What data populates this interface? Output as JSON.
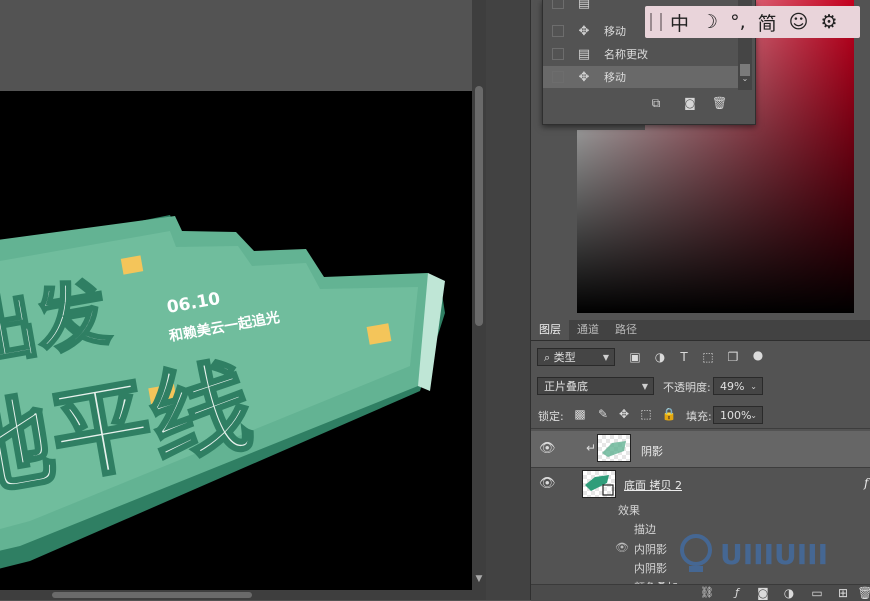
{
  "history": {
    "items": [
      {
        "label": "移动",
        "icon": "move-icon"
      },
      {
        "label": "名称更改",
        "icon": "document-icon"
      },
      {
        "label": "移动",
        "icon": "move-icon",
        "selected": true
      }
    ],
    "footer_icons": [
      "new-snapshot-icon",
      "camera-icon",
      "trash-icon"
    ]
  },
  "ime_bar": {
    "items": [
      "中",
      "☽",
      "°,",
      "简",
      "☺",
      "⚙"
    ]
  },
  "artwork": {
    "date": "06.10",
    "tagline": "和赖美云一起追光",
    "big_text_line1": "出发",
    "big_text_line2": "地平线",
    "colors": {
      "face": "#e6f1ec",
      "mint": "#63b393",
      "deep": "#2f7f63",
      "gold": "#f4c55a"
    }
  },
  "layers_panel": {
    "tabs": [
      "图层",
      "通道",
      "路径"
    ],
    "active_tab": "图层",
    "filter_kind": "类型",
    "blend_mode": "正片叠底",
    "opacity_label": "不透明度:",
    "opacity_value": "49%",
    "lock_label": "锁定:",
    "fill_label": "填充:",
    "fill_value": "100%",
    "layers": [
      {
        "name": "阴影",
        "selected": true,
        "clipped": true
      },
      {
        "name": "底面 拷贝 2",
        "has_fx": true
      }
    ],
    "effects_label": "效果",
    "effects": [
      "描边",
      "内阴影",
      "内阴影",
      "颜色叠加"
    ],
    "fx_symbol": "f"
  },
  "watermark": {
    "text": "UIIIUIII"
  }
}
